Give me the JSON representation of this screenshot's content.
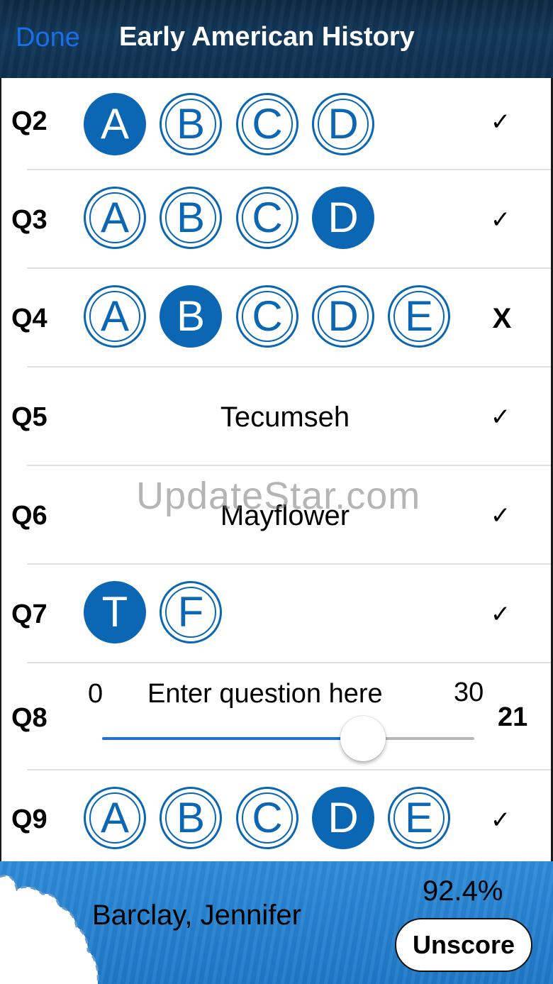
{
  "header": {
    "done_label": "Done",
    "title": "Early American History"
  },
  "questions": {
    "q2": {
      "label": "Q2",
      "choices": [
        "A",
        "B",
        "C",
        "D"
      ],
      "selected": "A",
      "result": "✓"
    },
    "q3": {
      "label": "Q3",
      "choices": [
        "A",
        "B",
        "C",
        "D"
      ],
      "selected": "D",
      "result": "✓"
    },
    "q4": {
      "label": "Q4",
      "choices": [
        "A",
        "B",
        "C",
        "D",
        "E"
      ],
      "selected": "B",
      "result": "X"
    },
    "q5": {
      "label": "Q5",
      "answer": "Tecumseh",
      "result": "✓"
    },
    "q6": {
      "label": "Q6",
      "answer": "Mayflower",
      "result": "✓"
    },
    "q7": {
      "label": "Q7",
      "choices": [
        "T",
        "F"
      ],
      "selected": "T",
      "result": "✓"
    },
    "q8": {
      "label": "Q8",
      "min": "0",
      "max": "30",
      "prompt": "Enter question here",
      "value": "21",
      "fraction": 0.7
    },
    "q9": {
      "label": "Q9",
      "choices": [
        "A",
        "B",
        "C",
        "D",
        "E"
      ],
      "selected": "D",
      "result": "✓"
    }
  },
  "watermark": "UpdateStar.com",
  "footer": {
    "student": "Barclay, Jennifer",
    "score": "92.4%",
    "unscore_label": "Unscore"
  },
  "colors": {
    "accent": "#0b66b3",
    "link": "#1a6fe8"
  }
}
